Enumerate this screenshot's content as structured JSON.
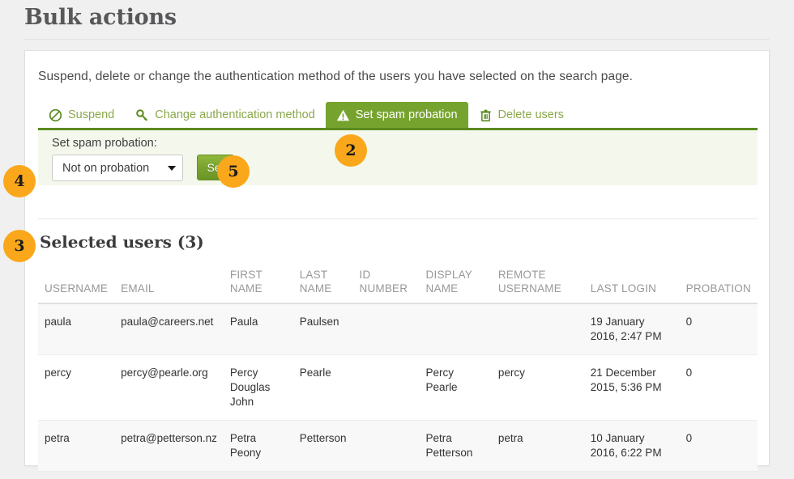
{
  "page": {
    "title": "Bulk actions"
  },
  "panel": {
    "intro": "Suspend, delete or change the authentication method of the users you have selected on the search page."
  },
  "tabs": [
    {
      "label": "Suspend",
      "icon": "ban-icon",
      "active": false
    },
    {
      "label": "Change authentication method",
      "icon": "key-icon",
      "active": false
    },
    {
      "label": "Set spam probation",
      "icon": "warning-triangle-icon",
      "active": true
    },
    {
      "label": "Delete users",
      "icon": "trash-icon",
      "active": false
    }
  ],
  "form": {
    "label": "Set spam probation:",
    "select_value": "Not on probation",
    "select_options": [
      "Not on probation"
    ],
    "submit_label": "Set"
  },
  "selected_users": {
    "heading": "Selected users (3)",
    "columns": [
      "USERNAME",
      "EMAIL",
      "FIRST NAME",
      "LAST NAME",
      "ID NUMBER",
      "DISPLAY NAME",
      "REMOTE USERNAME",
      "LAST LOGIN",
      "PROBATION"
    ],
    "rows": [
      {
        "username": "paula",
        "email": "paula@careers.net",
        "first_name": "Paula",
        "last_name": "Paulsen",
        "id_number": "",
        "display_name": "",
        "remote_username": "",
        "last_login": "19 January 2016, 2:47 PM",
        "probation": "0"
      },
      {
        "username": "percy",
        "email": "percy@pearle.org",
        "first_name": "Percy Douglas John",
        "last_name": "Pearle",
        "id_number": "",
        "display_name": "Percy Pearle",
        "remote_username": "percy",
        "last_login": "21 December 2015, 5:36 PM",
        "probation": "0"
      },
      {
        "username": "petra",
        "email": "petra@petterson.nz",
        "first_name": "Petra Peony",
        "last_name": "Petterson",
        "id_number": "",
        "display_name": "Petra Petterson",
        "remote_username": "petra",
        "last_login": "10 January 2016, 6:22 PM",
        "probation": "0"
      }
    ]
  },
  "callouts": [
    {
      "number": "2"
    },
    {
      "number": "3"
    },
    {
      "number": "4"
    },
    {
      "number": "5"
    }
  ],
  "colors": {
    "accent_green": "#76a32e",
    "tab_text_green": "#8aa84a",
    "badge_orange": "#faa71b",
    "form_bg": "#f4f8ec",
    "page_bg": "#f0f0f0"
  }
}
